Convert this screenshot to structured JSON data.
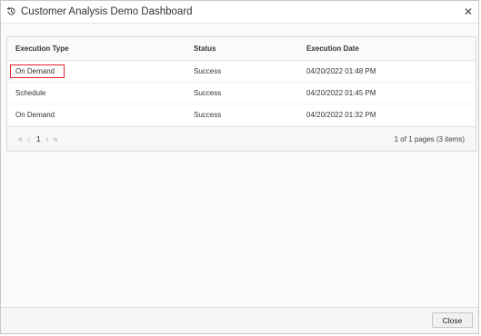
{
  "dialog": {
    "title": "Customer Analysis Demo Dashboard",
    "close_glyph": "✕",
    "history_icon": "history-icon"
  },
  "grid": {
    "columns": [
      "Execution Type",
      "Status",
      "Execution Date"
    ],
    "rows": [
      {
        "execution_type": "On Demand",
        "status": "Success",
        "execution_date": "04/20/2022 01:48 PM",
        "highlighted": true
      },
      {
        "execution_type": "Schedule",
        "status": "Success",
        "execution_date": "04/20/2022 01:45 PM",
        "highlighted": false
      },
      {
        "execution_type": "On Demand",
        "status": "Success",
        "execution_date": "04/20/2022 01:32 PM",
        "highlighted": false
      }
    ],
    "highlight_color": "#e0232e"
  },
  "pager": {
    "first": "«",
    "prev": "‹",
    "page": "1",
    "next": "›",
    "last": "»",
    "info": "1 of 1 pages (3 items)"
  },
  "footer": {
    "close_label": "Close"
  }
}
